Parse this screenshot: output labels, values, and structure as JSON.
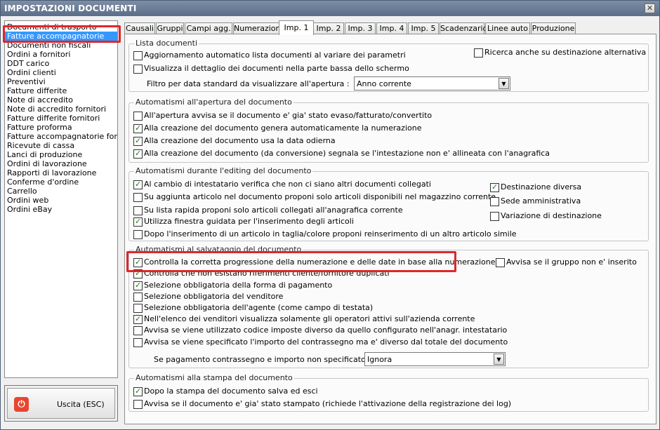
{
  "window": {
    "title": "IMPOSTAZIONI DOCUMENTI",
    "close_glyph": "✕"
  },
  "sidebar": {
    "items": [
      "Documenti di trasporto",
      "Fatture accompagnatorie",
      "Documenti non fiscali",
      "Ordini a fornitori",
      "DDT carico",
      "Ordini clienti",
      "Preventivi",
      "Fatture differite",
      "Note di accredito",
      "Note di accredito fornitori",
      "Fatture differite fornitori",
      "Fatture proforma",
      "Fatture accompagnatorie fornito",
      "Ricevute di cassa",
      "Lanci di produzione",
      "Ordini di lavorazione",
      "Rapporti di lavorazione",
      "Conferme d'ordine",
      "Carrello",
      "Ordini web",
      "Ordini eBay"
    ],
    "selected": "Fatture accompagnatorie"
  },
  "exit_button": {
    "label": "Uscita (ESC)",
    "icon": "power-icon"
  },
  "tabs": [
    "Causali",
    "Gruppi",
    "Campi agg.",
    "Numerazioni",
    "Imp. 1",
    "Imp. 2",
    "Imp. 3",
    "Imp. 4",
    "Imp. 5",
    "Scadenzario",
    "Linee auto",
    "Produzione"
  ],
  "active_tab": "Imp. 1",
  "groups": {
    "lista": {
      "title": "Lista documenti",
      "opts": [
        {
          "label": "Aggiornamento automatico lista documenti al variare dei parametri",
          "checked": false
        },
        {
          "label": "Visualizza il dettaglio dei documenti nella parte bassa dello schermo",
          "checked": false
        },
        {
          "label": "Ricerca anche su destinazione alternativa",
          "checked": false
        }
      ],
      "filter_label": "Filtro per data standard da visualizzare all'apertura :",
      "filter_value": "Anno corrente"
    },
    "apertura": {
      "title": "Automatismi all'apertura del documento",
      "opts": [
        {
          "label": "All'apertura avvisa se il documento e' gia' stato evaso/fatturato/convertito",
          "checked": false
        },
        {
          "label": "Alla creazione del documento genera automaticamente la numerazione",
          "checked": true
        },
        {
          "label": "Alla creazione del documento usa la data odierna",
          "checked": true
        },
        {
          "label": "Alla creazione del documento (da conversione) segnala se l'intestazione non e' allineata con l'anagrafica",
          "checked": true
        }
      ]
    },
    "editing": {
      "title": "Automatismi durante l'editing del documento",
      "opts": [
        {
          "label": "Al cambio di intestatario verifica che non ci siano altri documenti collegati",
          "checked": true
        },
        {
          "label": "Su aggiunta articolo nel documento proponi solo articoli disponibili nel magazzino corrente",
          "checked": false
        },
        {
          "label": "Su lista rapida proponi solo articoli collegati all'anagrafica corrente",
          "checked": false
        },
        {
          "label": "Utilizza finestra guidata per l'inserimento degli articoli",
          "checked": true
        },
        {
          "label": "Dopo l'inserimento di un articolo in taglia/colore proponi reinserimento di un altro articolo simile",
          "checked": false
        }
      ],
      "right_opts": [
        {
          "label": "Destinazione diversa",
          "checked": true
        },
        {
          "label": "Sede amministrativa",
          "checked": false
        },
        {
          "label": "Variazione di destinazione",
          "checked": false
        }
      ]
    },
    "salvataggio": {
      "title": "Automatismi al salvataggio del documento",
      "opts": [
        {
          "label": "Controlla la corretta progressione della numerazione e delle date in base alla numerazione",
          "checked": true
        },
        {
          "label": "Controlla che non esistano riferimenti cliente/fornitore duplicati",
          "checked": true
        },
        {
          "label": "Selezione obbligatoria della forma di pagamento",
          "checked": true
        },
        {
          "label": "Selezione obbligatoria del venditore",
          "checked": false
        },
        {
          "label": "Selezione obbligatoria dell'agente (come campo di testata)",
          "checked": false
        },
        {
          "label": "Nell'elenco dei venditori visualizza solamente gli operatori attivi sull'azienda corrente",
          "checked": true
        },
        {
          "label": "Avvisa se viene utilizzato codice imposte diverso da quello configurato nell'anagr. intestatario",
          "checked": false
        },
        {
          "label": "Avvisa se viene specificato l'importo del contrassegno ma e' diverso dal totale del documento",
          "checked": false
        }
      ],
      "right_opt": {
        "label": "Avvisa se il gruppo non e' inserito",
        "checked": false
      },
      "contr_label": "Se pagamento contrassegno e importo non specificato :",
      "contr_value": "Ignora"
    },
    "stampa": {
      "title": "Automatismi alla stampa del documento",
      "opts": [
        {
          "label": "Dopo la stampa del documento salva ed esci",
          "checked": true
        },
        {
          "label": "Avvisa se il documento e' gia' stato stampato (richiede l'attivazione della registrazione dei log)",
          "checked": false
        }
      ]
    }
  },
  "colors": {
    "highlight": "#e0262a",
    "selection": "#3399ff",
    "check": "#1a7a1a"
  }
}
